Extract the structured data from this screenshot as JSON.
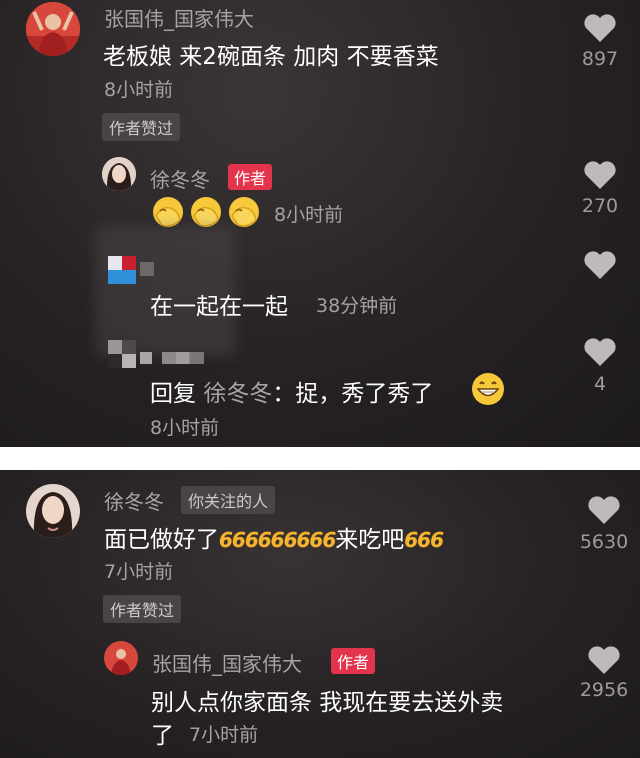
{
  "colors": {
    "badge_red": "#e3344c",
    "emoji_yellow": "#f6c83a",
    "six_gold": "#f5b531",
    "heart_grey": "#bfbaba"
  },
  "panel1": {
    "comment": {
      "username": "张国伟_国家伟大",
      "text": "老板娘 来2碗面条 加肉 不要香菜",
      "time": "8小时前",
      "liked_label": "作者赞过",
      "likes": "897"
    },
    "reply1": {
      "username": "徐冬冬",
      "badge": "作者",
      "time": "8小时前",
      "likes": "270",
      "emoji": "facepalm-emoji"
    },
    "reply2": {
      "text": "在一起在一起",
      "time": "38分钟前"
    },
    "reply3": {
      "prefix": "回复",
      "target": "徐冬冬",
      "text": "：捉，秀了秀了",
      "time": "8小时前",
      "likes": "4",
      "emoji": "grin-emoji"
    }
  },
  "panel2": {
    "comment": {
      "username": "徐冬冬",
      "tag": "你关注的人",
      "text_a": "面已做好了",
      "six": "666",
      "text_b": "来吃吧",
      "time": "7小时前",
      "liked_label": "作者赞过",
      "likes": "5630"
    },
    "reply": {
      "username": "张国伟_国家伟大",
      "badge": "作者",
      "line1": "别人点你家面条 我现在要去送外卖",
      "line2": "了",
      "time": "7小时前",
      "likes": "2956"
    }
  }
}
